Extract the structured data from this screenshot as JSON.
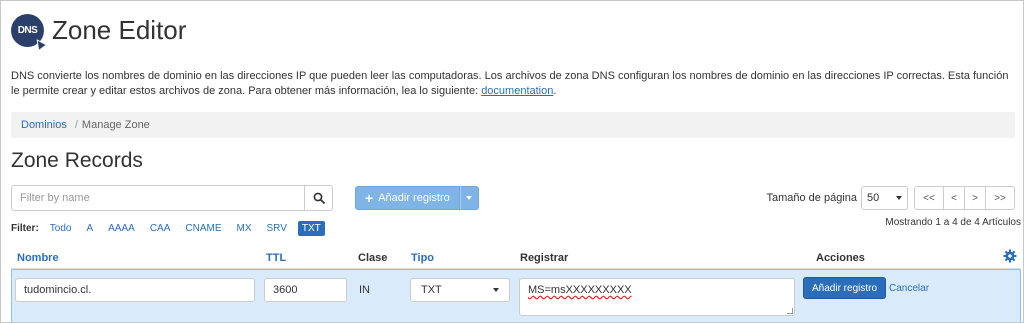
{
  "header": {
    "logo_text": "DNS",
    "title": "Zone Editor"
  },
  "description": {
    "text": "DNS convierte los nombres de dominio en las direcciones IP que pueden leer las computadoras. Los archivos de zona DNS configuran los nombres de dominio en las direcciones IP correctas. Esta función le permite crear y editar estos archivos de zona. Para obtener más información, lea lo siguiente: ",
    "link": "documentation",
    "end": "."
  },
  "breadcrumb": {
    "link": "Dominios",
    "separator": "/",
    "current": "Manage Zone"
  },
  "section_title": "Zone Records",
  "search": {
    "placeholder": "Filter by name",
    "icon": "search-icon"
  },
  "add_button": {
    "label": "Añadir registro",
    "icon": "plus-icon"
  },
  "pagination": {
    "page_size_label": "Tamaño de página",
    "page_size": "50",
    "first": "<<",
    "prev": "<",
    "next": ">",
    "last": ">>",
    "showing": "Mostrando 1 a 4 de 4 Artículos"
  },
  "filter": {
    "label": "Filter:",
    "items": [
      "Todo",
      "A",
      "AAAA",
      "CAA",
      "CNAME",
      "MX",
      "SRV",
      "TXT"
    ],
    "active": "TXT"
  },
  "table": {
    "headers": {
      "name": "Nombre",
      "ttl": "TTL",
      "class": "Clase",
      "type": "Tipo",
      "record": "Registrar",
      "actions": "Acciones"
    },
    "settings_icon": "gear-icon"
  },
  "edit_row": {
    "name": "tudomincio.cl.",
    "ttl": "3600",
    "class": "IN",
    "type": "TXT",
    "record": "MS=msXXXXXXXXX",
    "save_label": "Añadir registro",
    "cancel_label": "Cancelar"
  },
  "colors": {
    "accent": "#2a6ebb",
    "add_button_bg": "#7fb4e6",
    "edit_row_bg": "#d9ebfa",
    "logo_bg": "#2b3f6b"
  }
}
